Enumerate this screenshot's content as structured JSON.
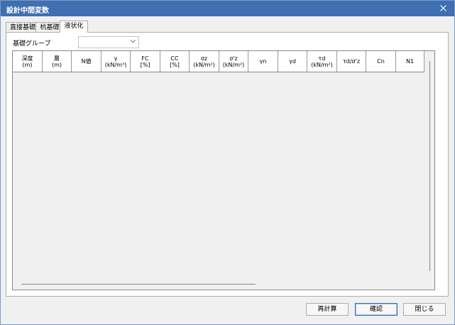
{
  "window": {
    "title": "設計中間変数"
  },
  "tabs": [
    {
      "label": "直接基礎",
      "active": false
    },
    {
      "label": "杭基礎",
      "active": false
    },
    {
      "label": "液状化",
      "active": true
    }
  ],
  "group": {
    "label": "基礎グループ",
    "value": ""
  },
  "table": {
    "columns": [
      {
        "line1": "深度",
        "line2": "(m)"
      },
      {
        "line1": "層",
        "line2": "(m)"
      },
      {
        "line1": "N値",
        "line2": ""
      },
      {
        "line1": "γ",
        "line2": "(kN/m³)"
      },
      {
        "line1": "FC",
        "line2": "[%]"
      },
      {
        "line1": "CC",
        "line2": "[%]"
      },
      {
        "line1": "σz",
        "line2": "(kN/m²)"
      },
      {
        "line1": "σ'z",
        "line2": "(kN/m²)"
      },
      {
        "line1": "γn",
        "line2": ""
      },
      {
        "line1": "γd",
        "line2": ""
      },
      {
        "line1": "τd",
        "line2": "(kN/m²)"
      },
      {
        "line1": "τd/σ'z",
        "line2": ""
      },
      {
        "line1": "Cn",
        "line2": ""
      },
      {
        "line1": "N1",
        "line2": ""
      }
    ],
    "rows": []
  },
  "buttons": {
    "recalc": "再計算",
    "ok": "確認",
    "close": "閉じる"
  },
  "colors": {
    "titlebar": "#3f6fb0",
    "accent": "#3f6fb0"
  }
}
